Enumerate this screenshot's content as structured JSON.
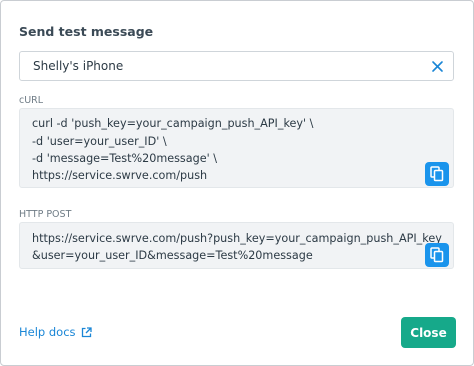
{
  "dialog": {
    "title": "Send test message"
  },
  "device": {
    "selected": "Shelly's iPhone",
    "clear_icon": "close-x-icon"
  },
  "curl": {
    "label": "cURL",
    "lines": [
      "curl -d 'push_key=your_campaign_push_API_key' \\",
      "-d 'user=your_user_ID' \\",
      "-d 'message=Test%20message' \\",
      "https://service.swrve.com/push"
    ],
    "copy_icon": "copy-icon"
  },
  "http_post": {
    "label": "HTTP POST",
    "lines": [
      "https://service.swrve.com/push?push_key=your_campaign_push_API_key",
      "&user=your_user_ID&message=Test%20message"
    ],
    "copy_icon": "copy-icon"
  },
  "footer": {
    "help_label": "Help docs",
    "help_icon": "external-link-icon",
    "close_label": "Close"
  },
  "colors": {
    "accent_blue": "#1a94ec",
    "link_blue": "#1a86d6",
    "close_green": "#16a98a",
    "code_bg": "#f1f3f5"
  }
}
